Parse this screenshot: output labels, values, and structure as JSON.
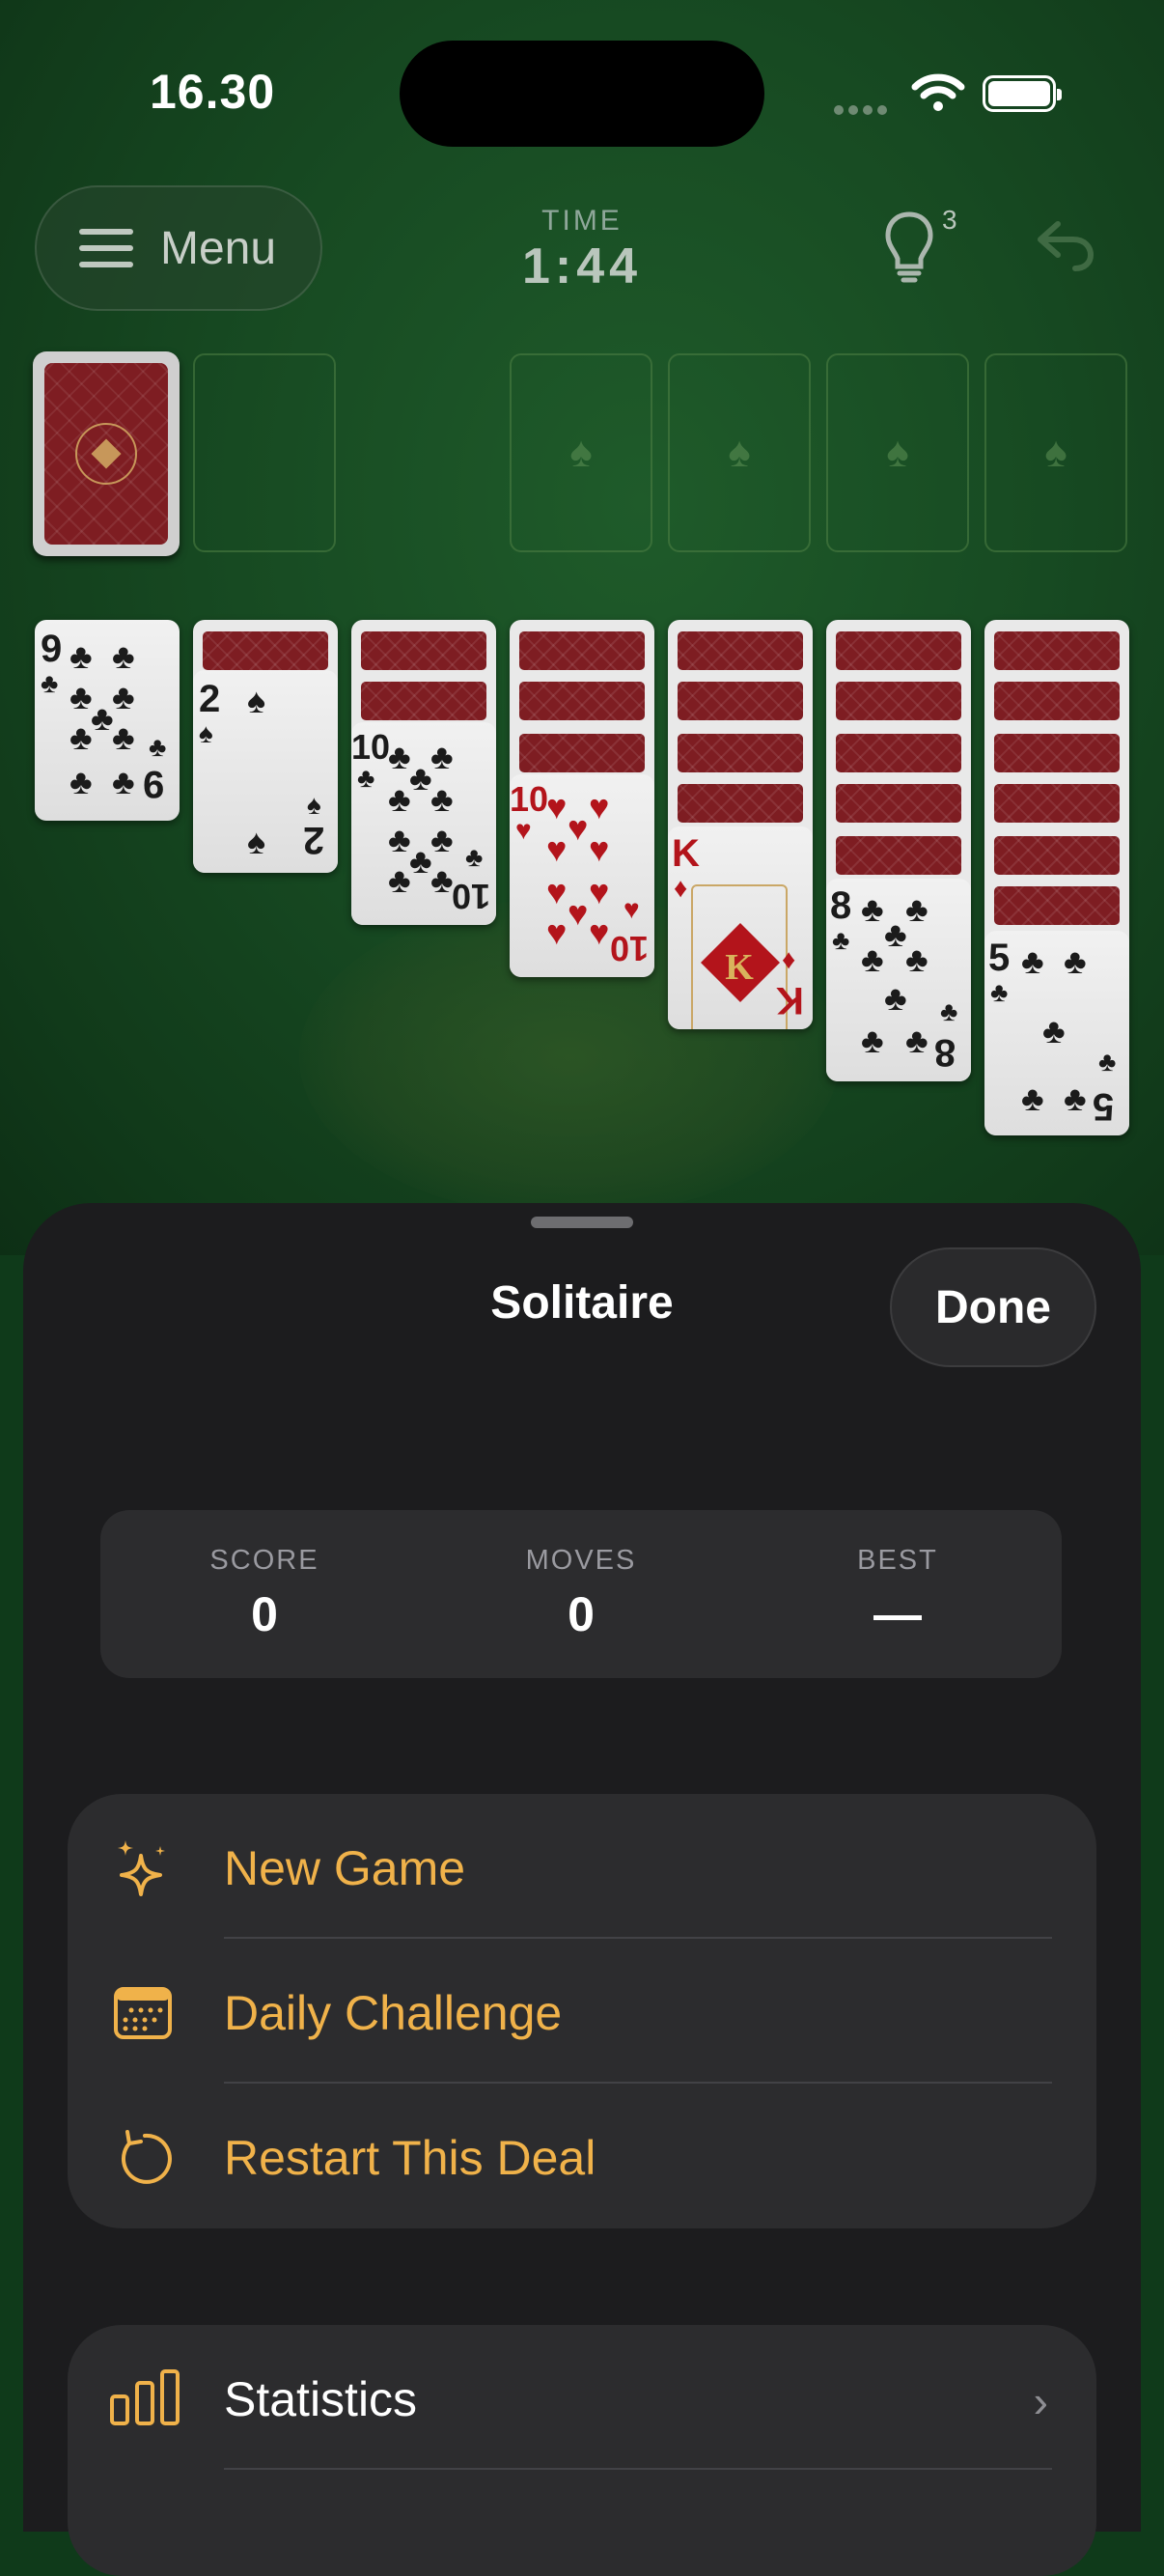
{
  "status_bar": {
    "time": "16.30"
  },
  "header": {
    "menu_label": "Menu",
    "time_caption": "TIME",
    "time_value": "1:44",
    "hint_count": "3"
  },
  "board": {
    "tableau": [
      {
        "face_down": 0,
        "face_up": {
          "rank": "9",
          "suit": "♣",
          "color": "black"
        }
      },
      {
        "face_down": 1,
        "face_up": {
          "rank": "2",
          "suit": "♠",
          "color": "black"
        }
      },
      {
        "face_down": 2,
        "face_up": {
          "rank": "10",
          "suit": "♣",
          "color": "black"
        }
      },
      {
        "face_down": 3,
        "face_up": {
          "rank": "10",
          "suit": "♥",
          "color": "red"
        }
      },
      {
        "face_down": 4,
        "face_up": {
          "rank": "K",
          "suit": "♦",
          "color": "red"
        }
      },
      {
        "face_down": 5,
        "face_up": {
          "rank": "8",
          "suit": "♣",
          "color": "black"
        }
      },
      {
        "face_down": 6,
        "face_up": {
          "rank": "5",
          "suit": "♣",
          "color": "black"
        }
      }
    ],
    "foundation_icon": "spade-icon",
    "card_back_color": "#7e1d22"
  },
  "sheet": {
    "title": "Solitaire",
    "done_label": "Done",
    "stats": {
      "score_caption": "SCORE",
      "score_value": "0",
      "moves_caption": "MOVES",
      "moves_value": "0",
      "best_caption": "BEST",
      "best_value": "—"
    },
    "actions": [
      {
        "label": "New Game",
        "icon": "sparkles-icon"
      },
      {
        "label": "Daily Challenge",
        "icon": "calendar-icon"
      },
      {
        "label": "Restart This Deal",
        "icon": "restart-icon"
      }
    ],
    "more": [
      {
        "label": "Statistics",
        "icon": "chart-bars-icon"
      }
    ],
    "accent_color": "#f0b24a"
  }
}
